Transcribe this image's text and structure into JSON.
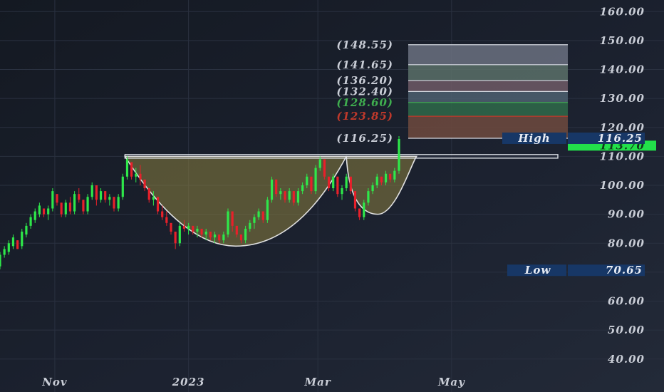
{
  "chart_data": {
    "type": "candlestick",
    "y_ticks": [
      "160.00",
      "150.00",
      "140.00",
      "130.00",
      "120.00",
      "110.00",
      "100.00",
      "90.00",
      "80.00",
      "70.00",
      "60.00",
      "50.00",
      "40.00"
    ],
    "ylim": [
      36,
      164
    ],
    "x_ticks": [
      {
        "label": "Nov",
        "day": 0
      },
      {
        "label": "2023",
        "day": 61
      },
      {
        "label": "Mar",
        "day": 120
      },
      {
        "label": "May",
        "day": 181
      }
    ],
    "xlim": [
      -25,
      235
    ],
    "price_label": "113.70",
    "high_label": "High",
    "high_value": "116.25",
    "low_label": "Low",
    "low_value": "70.65",
    "resistance_level": 110,
    "fib_levels": [
      {
        "label": "(148.55)",
        "value": 148.55,
        "color": "#c9cdd6"
      },
      {
        "label": "(141.65)",
        "value": 141.65,
        "color": "#c9cdd6"
      },
      {
        "label": "(136.20)",
        "value": 136.2,
        "color": "#c9cdd6"
      },
      {
        "label": "(132.40)",
        "value": 132.4,
        "color": "#c9cdd6"
      },
      {
        "label": "(128.60)",
        "value": 128.6,
        "color": "#3fae4f"
      },
      {
        "label": "(123.85)",
        "value": 123.85,
        "color": "#c0392b"
      },
      {
        "label": "(116.25)",
        "value": 116.25,
        "color": "#c9cdd6"
      }
    ],
    "cup": {
      "start_day": 32,
      "end_day": 133,
      "bottom": 79
    },
    "handle": {
      "start_day": 133,
      "end_day": 165,
      "bottom": 90
    },
    "candles": [
      [
        -25,
        72,
        77,
        71,
        76
      ],
      [
        -23,
        76,
        79,
        75,
        78
      ],
      [
        -21,
        77,
        81,
        76,
        80
      ],
      [
        -19,
        79,
        83,
        78,
        82
      ],
      [
        -17,
        81,
        80,
        79,
        78
      ],
      [
        -15,
        79,
        85,
        78,
        84
      ],
      [
        -13,
        83,
        87,
        82,
        86
      ],
      [
        -11,
        86,
        90,
        85,
        89
      ],
      [
        -9,
        88,
        92,
        87,
        91
      ],
      [
        -7,
        90,
        94,
        89,
        93
      ],
      [
        -5,
        92,
        91,
        89,
        90
      ],
      [
        -3,
        90,
        93,
        88,
        92
      ],
      [
        -1,
        92,
        99,
        91,
        98
      ],
      [
        1,
        97,
        96,
        93,
        94
      ],
      [
        3,
        94,
        92,
        89,
        90
      ],
      [
        5,
        90,
        95,
        89,
        94
      ],
      [
        7,
        94,
        96,
        90,
        91
      ],
      [
        9,
        91,
        98,
        90,
        97
      ],
      [
        11,
        97,
        99,
        94,
        95
      ],
      [
        13,
        95,
        93,
        90,
        91
      ],
      [
        15,
        91,
        97,
        90,
        96
      ],
      [
        17,
        96,
        101,
        95,
        100
      ],
      [
        19,
        100,
        96,
        93,
        95
      ],
      [
        21,
        95,
        99,
        94,
        98
      ],
      [
        23,
        98,
        97,
        94,
        95
      ],
      [
        25,
        95,
        97,
        93,
        96
      ],
      [
        27,
        96,
        94,
        91,
        92
      ],
      [
        29,
        92,
        97,
        91,
        96
      ],
      [
        31,
        96,
        104,
        95,
        103
      ],
      [
        33,
        103,
        110,
        102,
        109
      ],
      [
        35,
        108,
        106,
        102,
        103
      ],
      [
        37,
        103,
        106,
        101,
        104
      ],
      [
        39,
        104,
        107,
        100,
        102
      ],
      [
        41,
        102,
        101,
        98,
        99
      ],
      [
        43,
        99,
        97,
        94,
        95
      ],
      [
        45,
        95,
        98,
        93,
        96
      ],
      [
        47,
        96,
        93,
        90,
        91
      ],
      [
        49,
        91,
        93,
        88,
        89
      ],
      [
        51,
        89,
        91,
        86,
        87
      ],
      [
        53,
        87,
        86,
        83,
        84
      ],
      [
        55,
        84,
        82,
        78,
        80
      ],
      [
        57,
        80,
        87,
        79,
        86
      ],
      [
        59,
        86,
        88,
        84,
        85
      ],
      [
        61,
        85,
        87,
        83,
        86
      ],
      [
        63,
        86,
        85,
        83,
        84
      ],
      [
        65,
        84,
        86,
        82,
        85
      ],
      [
        67,
        85,
        84,
        82,
        83
      ],
      [
        69,
        83,
        85,
        81,
        84
      ],
      [
        71,
        84,
        83,
        81,
        82
      ],
      [
        73,
        82,
        84,
        80,
        83
      ],
      [
        75,
        83,
        82,
        80,
        81
      ],
      [
        77,
        81,
        84,
        80,
        83
      ],
      [
        79,
        83,
        92,
        82,
        91
      ],
      [
        81,
        91,
        88,
        84,
        86
      ],
      [
        83,
        86,
        85,
        82,
        83
      ],
      [
        85,
        83,
        82,
        80,
        81
      ],
      [
        87,
        81,
        86,
        80,
        85
      ],
      [
        89,
        85,
        88,
        84,
        87
      ],
      [
        91,
        87,
        90,
        85,
        89
      ],
      [
        93,
        89,
        92,
        88,
        91
      ],
      [
        95,
        91,
        90,
        87,
        88
      ],
      [
        97,
        88,
        96,
        87,
        95
      ],
      [
        99,
        95,
        103,
        94,
        102
      ],
      [
        101,
        102,
        100,
        96,
        97
      ],
      [
        103,
        97,
        99,
        95,
        98
      ],
      [
        105,
        98,
        97,
        94,
        95
      ],
      [
        107,
        95,
        99,
        94,
        98
      ],
      [
        109,
        98,
        97,
        93,
        94
      ],
      [
        111,
        94,
        99,
        93,
        98
      ],
      [
        113,
        98,
        101,
        97,
        100
      ],
      [
        115,
        100,
        104,
        99,
        103
      ],
      [
        117,
        103,
        101,
        97,
        98
      ],
      [
        119,
        98,
        107,
        97,
        106
      ],
      [
        121,
        106,
        110,
        105,
        109
      ],
      [
        123,
        109,
        106,
        102,
        103
      ],
      [
        125,
        103,
        101,
        98,
        99
      ],
      [
        127,
        99,
        104,
        98,
        103
      ],
      [
        129,
        103,
        101,
        96,
        97
      ],
      [
        131,
        97,
        100,
        95,
        99
      ],
      [
        133,
        99,
        104,
        98,
        103
      ],
      [
        135,
        103,
        100,
        97,
        98
      ],
      [
        137,
        98,
        95,
        91,
        92
      ],
      [
        139,
        92,
        90,
        88,
        89
      ],
      [
        141,
        89,
        95,
        88,
        94
      ],
      [
        143,
        94,
        99,
        93,
        98
      ],
      [
        145,
        98,
        101,
        97,
        100
      ],
      [
        147,
        100,
        104,
        99,
        103
      ],
      [
        149,
        103,
        102,
        100,
        101
      ],
      [
        151,
        101,
        105,
        100,
        104
      ],
      [
        153,
        104,
        103,
        101,
        102
      ],
      [
        155,
        102,
        106,
        101,
        105
      ],
      [
        157,
        105,
        117,
        104,
        116
      ]
    ]
  }
}
